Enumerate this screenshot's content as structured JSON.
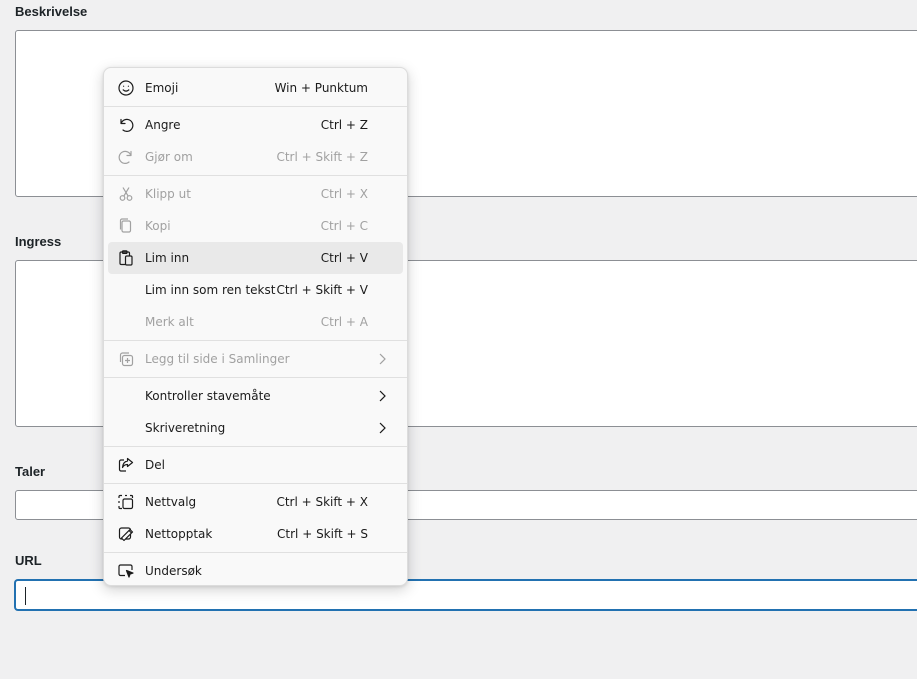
{
  "form": {
    "description_label": "Beskrivelse",
    "ingress_label": "Ingress",
    "speaker_label": "Taler",
    "url_label": "URL",
    "url_value": ""
  },
  "menu": {
    "emoji": {
      "label": "Emoji",
      "shortcut": "Win + Punktum"
    },
    "undo": {
      "label": "Angre",
      "shortcut": "Ctrl + Z"
    },
    "redo": {
      "label": "Gjør om",
      "shortcut": "Ctrl + Skift + Z"
    },
    "cut": {
      "label": "Klipp ut",
      "shortcut": "Ctrl + X"
    },
    "copy": {
      "label": "Kopi",
      "shortcut": "Ctrl + C"
    },
    "paste": {
      "label": "Lim inn",
      "shortcut": "Ctrl + V"
    },
    "paste_plain": {
      "label": "Lim inn som ren tekst",
      "shortcut": "Ctrl + Skift + V"
    },
    "select_all": {
      "label": "Merk alt",
      "shortcut": "Ctrl + A"
    },
    "add_to_collections": {
      "label": "Legg til side i Samlinger"
    },
    "spellcheck": {
      "label": "Kontroller stavemåte"
    },
    "writing_direction": {
      "label": "Skriveretning"
    },
    "share": {
      "label": "Del"
    },
    "web_select": {
      "label": "Nettvalg",
      "shortcut": "Ctrl + Skift + X"
    },
    "web_capture": {
      "label": "Nettopptak",
      "shortcut": "Ctrl + Skift + S"
    },
    "inspect": {
      "label": "Undersøk"
    }
  },
  "colors": {
    "background": "#f0f0f1",
    "menu_background": "#f9f9f9",
    "hover": "#e9e9e9",
    "focus_border": "#2271b1",
    "disabled_text": "#a1a1a1"
  }
}
